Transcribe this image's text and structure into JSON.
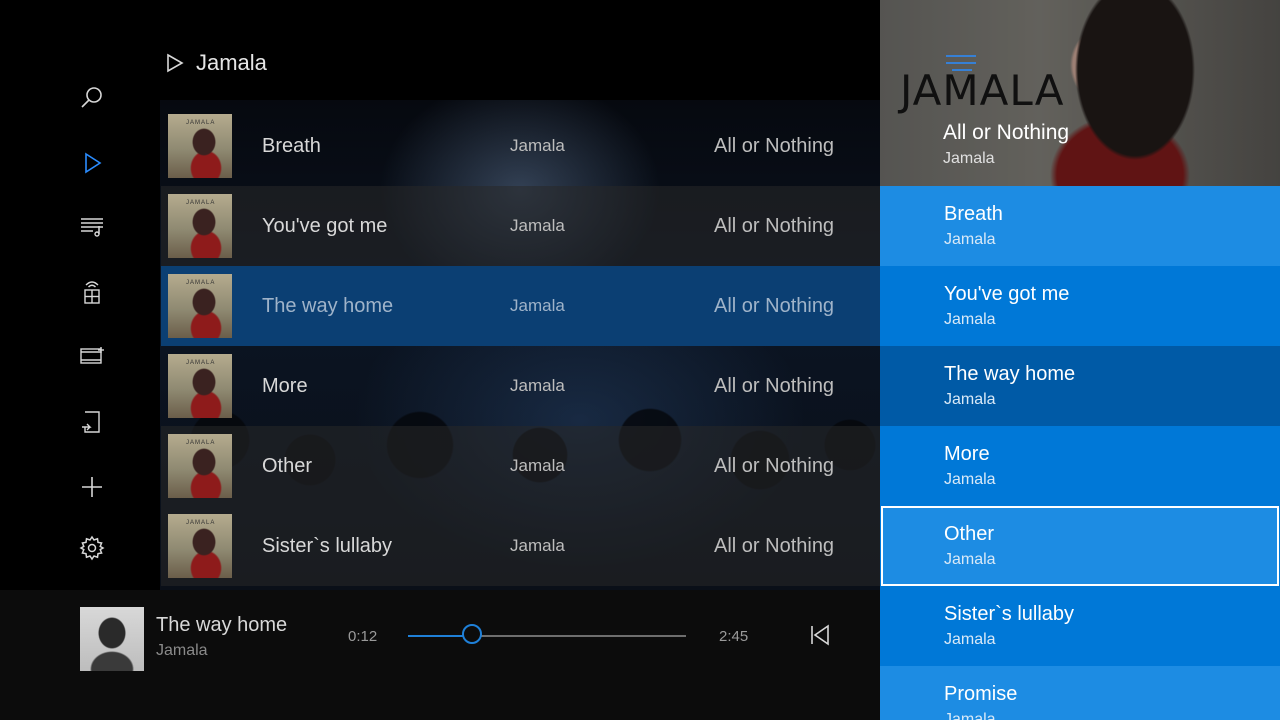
{
  "header": {
    "title": "Jamala"
  },
  "sidebar": {
    "items": [
      {
        "icon": "search-icon",
        "active": false
      },
      {
        "icon": "now-playing-icon",
        "active": true
      },
      {
        "icon": "playlist-icon",
        "active": false
      },
      {
        "icon": "media-server-icon",
        "active": false
      },
      {
        "icon": "video-library-icon",
        "active": false
      },
      {
        "icon": "device-icon",
        "active": false
      },
      {
        "icon": "add-icon",
        "active": false
      },
      {
        "icon": "settings-icon",
        "active": false
      }
    ]
  },
  "songs": [
    {
      "title": "Breath",
      "artist": "Jamala",
      "album": "All or Nothing"
    },
    {
      "title": "You've got me",
      "artist": "Jamala",
      "album": "All or Nothing"
    },
    {
      "title": "The way home",
      "artist": "Jamala",
      "album": "All or Nothing"
    },
    {
      "title": "More",
      "artist": "Jamala",
      "album": "All or Nothing"
    },
    {
      "title": "Other",
      "artist": "Jamala",
      "album": "All or Nothing"
    },
    {
      "title": "Sister`s lullaby",
      "artist": "Jamala",
      "album": "All or Nothing"
    }
  ],
  "now_playing": {
    "title": "The way home",
    "artist": "Jamala",
    "elapsed": "0:12",
    "duration": "2:45",
    "progress": 0.23
  },
  "panel": {
    "logo_text": "JAMALA",
    "album": "All or Nothing",
    "artist": "Jamala",
    "queue": [
      {
        "title": "Breath",
        "artist": "Jamala"
      },
      {
        "title": "You've got me",
        "artist": "Jamala"
      },
      {
        "title": "The way home",
        "artist": "Jamala"
      },
      {
        "title": "More",
        "artist": "Jamala"
      },
      {
        "title": "Other",
        "artist": "Jamala"
      },
      {
        "title": "Sister`s lullaby",
        "artist": "Jamala"
      },
      {
        "title": "Promise",
        "artist": "Jamala"
      }
    ]
  },
  "colors": {
    "accent": "#0078d7",
    "selected_row": "#0b3f73",
    "active_icon": "#2a8cff"
  }
}
